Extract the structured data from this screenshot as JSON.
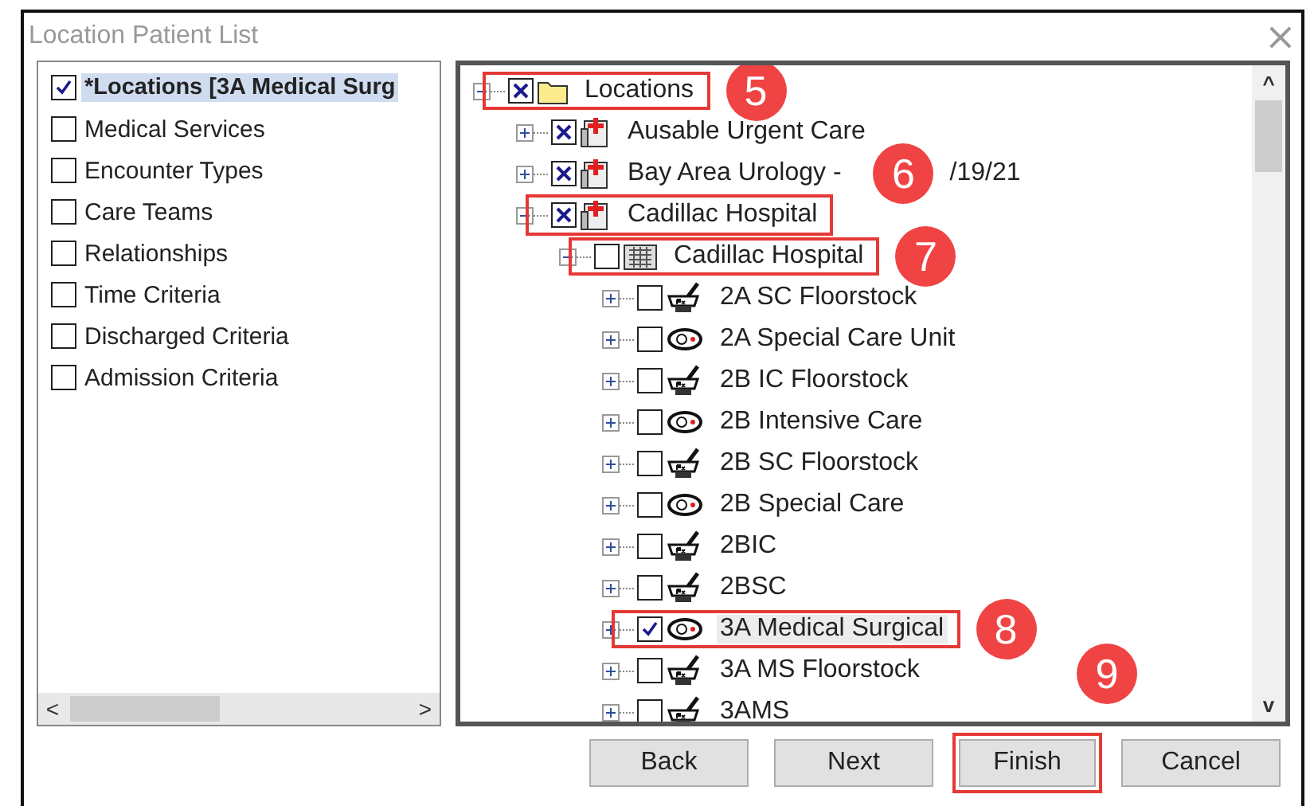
{
  "window": {
    "title": "Location Patient List",
    "close": "×"
  },
  "filters": [
    {
      "label": "*Locations [3A Medical Surg",
      "checked": true,
      "selected": true
    },
    {
      "label": "Medical Services",
      "checked": false,
      "selected": false
    },
    {
      "label": "Encounter Types",
      "checked": false,
      "selected": false
    },
    {
      "label": "Care Teams",
      "checked": false,
      "selected": false
    },
    {
      "label": "Relationships",
      "checked": false,
      "selected": false
    },
    {
      "label": "Time Criteria",
      "checked": false,
      "selected": false
    },
    {
      "label": "Discharged Criteria",
      "checked": false,
      "selected": false
    },
    {
      "label": "Admission Criteria",
      "checked": false,
      "selected": false
    }
  ],
  "tree": [
    {
      "label": "Locations",
      "kind": "folder",
      "checkbox": {
        "checked": true,
        "kind": "cross"
      },
      "expanded": true,
      "highlighted": true,
      "badge": "5",
      "children": [
        {
          "label": "Ausable Urgent Care",
          "kind": "hospital",
          "checkbox": {
            "checked": true,
            "kind": "cross"
          },
          "expanded": false,
          "highlighted": false
        },
        {
          "label": "Bay Area Urology -",
          "label_tail": "/19/21",
          "kind": "hospital",
          "checkbox": {
            "checked": true,
            "kind": "cross"
          },
          "expanded": false,
          "highlighted": false,
          "badge": "6"
        },
        {
          "label": "Cadillac Hospital",
          "kind": "hospital",
          "checkbox": {
            "checked": true,
            "kind": "cross"
          },
          "expanded": true,
          "highlighted": true,
          "children": [
            {
              "label": "Cadillac Hospital",
              "kind": "building",
              "checkbox": {
                "checked": false
              },
              "expanded": true,
              "highlighted": true,
              "badge": "7",
              "children": [
                {
                  "label": "2A SC Floorstock",
                  "kind": "pharmacy",
                  "checkbox": {
                    "checked": false
                  },
                  "expanded": false,
                  "highlighted": false
                },
                {
                  "label": "2A Special Care Unit",
                  "kind": "unit",
                  "checkbox": {
                    "checked": false
                  },
                  "expanded": false,
                  "highlighted": false
                },
                {
                  "label": "2B IC Floorstock",
                  "kind": "pharmacy",
                  "checkbox": {
                    "checked": false
                  },
                  "expanded": false,
                  "highlighted": false
                },
                {
                  "label": "2B Intensive Care",
                  "kind": "unit",
                  "checkbox": {
                    "checked": false
                  },
                  "expanded": false,
                  "highlighted": false
                },
                {
                  "label": "2B SC Floorstock",
                  "kind": "pharmacy",
                  "checkbox": {
                    "checked": false
                  },
                  "expanded": false,
                  "highlighted": false
                },
                {
                  "label": "2B Special Care",
                  "kind": "unit",
                  "checkbox": {
                    "checked": false
                  },
                  "expanded": false,
                  "highlighted": false
                },
                {
                  "label": "2BIC",
                  "kind": "pharmacy",
                  "checkbox": {
                    "checked": false
                  },
                  "expanded": false,
                  "highlighted": false
                },
                {
                  "label": "2BSC",
                  "kind": "pharmacy",
                  "checkbox": {
                    "checked": false
                  },
                  "expanded": false,
                  "highlighted": false
                },
                {
                  "label": "3A Medical Surgical",
                  "kind": "unit",
                  "checkbox": {
                    "checked": true,
                    "kind": "tick"
                  },
                  "expanded": false,
                  "highlighted": true,
                  "selected": true,
                  "badge": "8"
                },
                {
                  "label": "3A MS Floorstock",
                  "kind": "pharmacy",
                  "checkbox": {
                    "checked": false
                  },
                  "expanded": false,
                  "highlighted": false
                },
                {
                  "label": "3AMS",
                  "kind": "pharmacy",
                  "checkbox": {
                    "checked": false
                  },
                  "expanded": false,
                  "highlighted": false
                }
              ]
            }
          ]
        }
      ]
    }
  ],
  "left_scrollbar": {
    "left": "<",
    "right": ">"
  },
  "tree_scrollbar": {
    "up": "^",
    "down": "v"
  },
  "buttons": [
    {
      "label": "Back",
      "highlighted": false
    },
    {
      "label": "Next",
      "highlighted": false
    },
    {
      "label": "Finish",
      "highlighted": true,
      "badge": "9"
    },
    {
      "label": "Cancel",
      "highlighted": false
    }
  ]
}
